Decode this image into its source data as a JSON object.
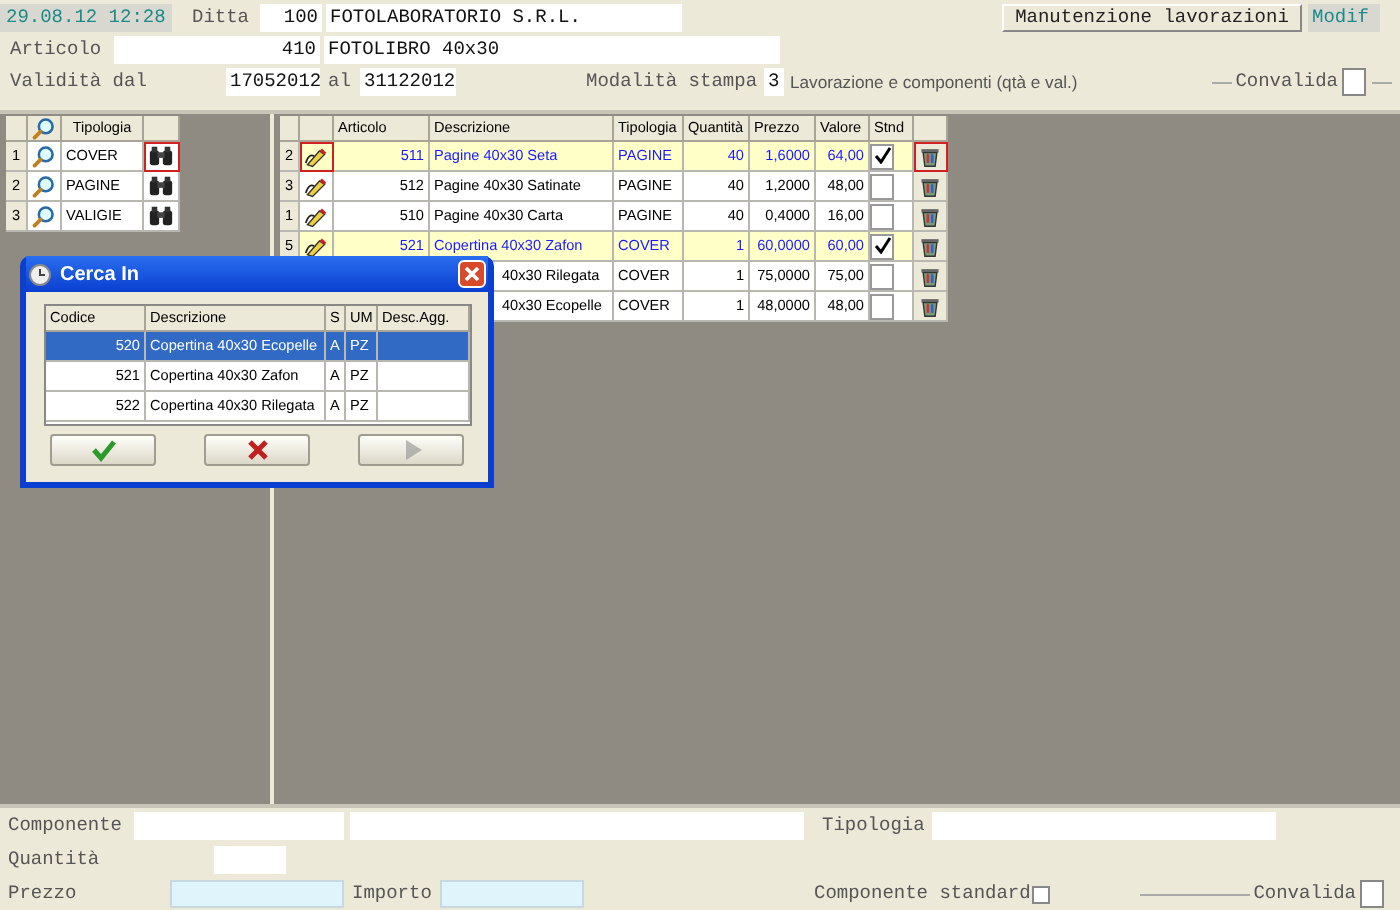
{
  "top": {
    "datetime": "29.08.12 12:28",
    "ditta_label": "Ditta",
    "ditta_code": "100",
    "ditta_name": "FOTOLABORATORIO S.R.L.",
    "button": "Manutenzione lavorazioni",
    "mode": "Modif",
    "articolo_label": "Articolo",
    "articolo_code": "410",
    "articolo_name": "FOTOLIBRO 40x30",
    "validita_label": "Validità dal",
    "from": "17052012",
    "al_label": "al",
    "to": "31122012",
    "modalita_label": "Modalità stampa",
    "modalita_value": "3",
    "modalita_text": "Lavorazione e componenti (qtà e val.)",
    "convalida_label": "Convalida",
    "convalida_checked": false
  },
  "types_grid": {
    "columns": [
      "Tipologia"
    ],
    "rows": [
      {
        "index": "1",
        "name": "COVER",
        "focused": true
      },
      {
        "index": "2",
        "name": "PAGINE",
        "focused": false
      },
      {
        "index": "3",
        "name": "VALIGIE",
        "focused": false
      }
    ]
  },
  "components_grid": {
    "columns": [
      "Articolo",
      "Descrizione",
      "Tipologia",
      "Quantità",
      "Prezzo",
      "Valore",
      "Stnd"
    ],
    "rows": [
      {
        "kind": "full",
        "index": "2",
        "articolo": "511",
        "descrizione": "Pagine 40x30 Seta",
        "tipologia": "PAGINE",
        "quantita": "40",
        "prezzo": "1,6000",
        "valore": "64,00",
        "standard": true,
        "highlighted": true,
        "focused": true
      },
      {
        "kind": "full",
        "index": "3",
        "articolo": "512",
        "descrizione": "Pagine 40x30 Satinate",
        "tipologia": "PAGINE",
        "quantita": "40",
        "prezzo": "1,2000",
        "valore": "48,00",
        "standard": false,
        "highlighted": false,
        "focused": false
      },
      {
        "kind": "full",
        "index": "1",
        "articolo": "510",
        "descrizione": "Pagine 40x30 Carta",
        "tipologia": "PAGINE",
        "quantita": "40",
        "prezzo": "0,4000",
        "valore": "16,00",
        "standard": false,
        "highlighted": false,
        "focused": false
      },
      {
        "kind": "full",
        "index": "5",
        "articolo": "521",
        "descrizione": "Copertina 40x30 Zafon",
        "tipologia": "COVER",
        "quantita": "1",
        "prezzo": "60,0000",
        "valore": "60,00",
        "standard": true,
        "highlighted": true,
        "focused": false
      },
      {
        "kind": "covered",
        "descrizione": "40x30 Rilegata",
        "tipologia": "COVER",
        "quantita": "1",
        "prezzo": "75,0000",
        "valore": "75,00",
        "standard": false,
        "highlighted": false,
        "focused": false
      },
      {
        "kind": "covered",
        "descrizione": "40x30 Ecopelle",
        "tipologia": "COVER",
        "quantita": "1",
        "prezzo": "48,0000",
        "valore": "48,00",
        "standard": false,
        "highlighted": false,
        "focused": false
      }
    ]
  },
  "dialog": {
    "title": "Cerca In",
    "columns": [
      "Codice",
      "Descrizione",
      "S",
      "UM",
      "Desc.Agg."
    ],
    "rows": [
      {
        "codice": "520",
        "descrizione": "Copertina 40x30 Ecopelle",
        "s": "A",
        "um": "PZ",
        "selected": true
      },
      {
        "codice": "521",
        "descrizione": "Copertina 40x30 Zafon",
        "s": "A",
        "um": "PZ",
        "selected": false
      },
      {
        "codice": "522",
        "descrizione": "Copertina 40x30 Rilegata",
        "s": "A",
        "um": "PZ",
        "selected": false
      }
    ],
    "buttons": [
      {
        "kind": "ok",
        "disabled": false
      },
      {
        "kind": "cancel",
        "disabled": false
      },
      {
        "kind": "next",
        "disabled": true
      }
    ]
  },
  "bottom": {
    "componente_label": "Componente",
    "tipologia_label": "Tipologia",
    "quantita_label": "Quantità",
    "prezzo_label": "Prezzo",
    "importo_label": "Importo",
    "standard_label": "Componente standard",
    "standard_checked": false,
    "convalida_label": "Convalida",
    "convalida_checked": false
  }
}
